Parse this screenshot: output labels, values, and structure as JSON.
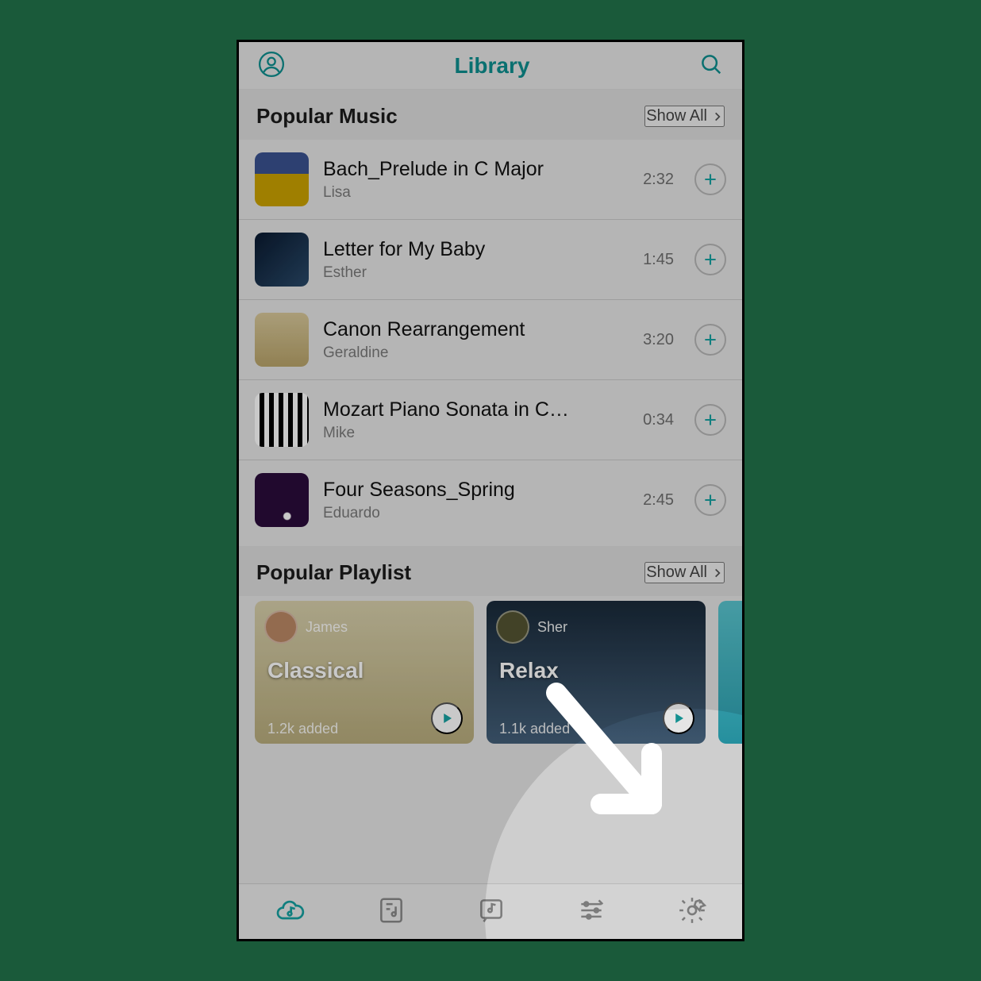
{
  "header": {
    "title": "Library"
  },
  "sections": {
    "popular_music": {
      "heading": "Popular Music",
      "show_all": "Show All",
      "tracks": [
        {
          "title": "Bach_Prelude in C Major",
          "artist": "Lisa",
          "duration": "2:32"
        },
        {
          "title": "Letter for My Baby",
          "artist": "Esther",
          "duration": "1:45"
        },
        {
          "title": "Canon Rearrangement",
          "artist": "Geraldine",
          "duration": "3:20"
        },
        {
          "title": "Mozart Piano Sonata in C…",
          "artist": "Mike",
          "duration": "0:34"
        },
        {
          "title": "Four Seasons_Spring",
          "artist": "Eduardo",
          "duration": "2:45"
        }
      ]
    },
    "popular_playlist": {
      "heading": "Popular Playlist",
      "show_all": "Show All",
      "cards": [
        {
          "user": "James",
          "name": "Classical",
          "meta": "1.2k added"
        },
        {
          "user": "Sher",
          "name": "Relax",
          "meta": "1.1k added"
        },
        {
          "user": "",
          "name": "",
          "meta": ""
        }
      ]
    }
  },
  "tabs": {
    "items": [
      "cloud-music",
      "playlist",
      "note-post",
      "equalizer",
      "settings"
    ],
    "active_index": 0,
    "callout_index": 4
  },
  "colors": {
    "accent": "#17a2a2"
  }
}
